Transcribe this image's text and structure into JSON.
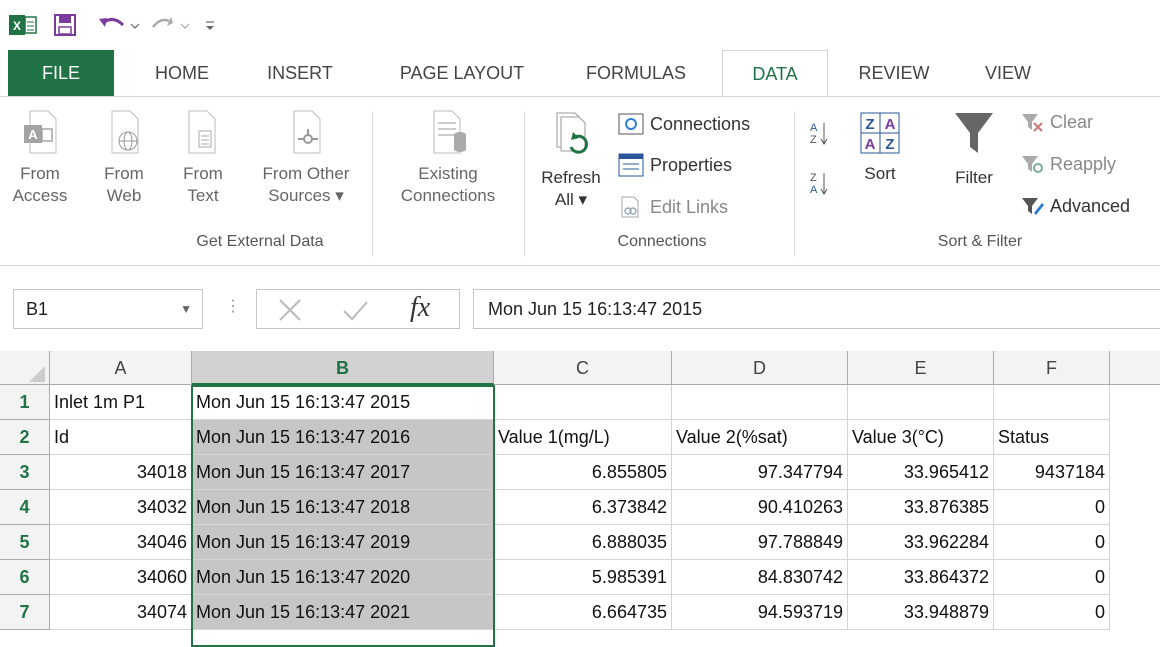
{
  "tabs": [
    "FILE",
    "HOME",
    "INSERT",
    "PAGE LAYOUT",
    "FORMULAS",
    "DATA",
    "REVIEW",
    "VIEW"
  ],
  "ribbon": {
    "get_external": {
      "from_access": [
        "From",
        "Access"
      ],
      "from_web": [
        "From",
        "Web"
      ],
      "from_text": [
        "From",
        "Text"
      ],
      "from_other": [
        "From Other",
        "Sources ▾"
      ],
      "existing": [
        "Existing",
        "Connections"
      ],
      "group_label": "Get External Data"
    },
    "connections": {
      "refresh": [
        "Refresh",
        "All ▾"
      ],
      "connections": "Connections",
      "properties": "Properties",
      "edit_links": "Edit Links",
      "group_label": "Connections"
    },
    "sort_filter": {
      "sort": "Sort",
      "filter": "Filter",
      "clear": "Clear",
      "reapply": "Reapply",
      "advanced": "Advanced",
      "group_label": "Sort & Filter"
    }
  },
  "formula_bar": {
    "name_box": "B1",
    "content": "Mon Jun 15 16:13:47 2015"
  },
  "sheet": {
    "columns": [
      "A",
      "B",
      "C",
      "D",
      "E",
      "F"
    ],
    "rows": [
      {
        "num": "1",
        "cells": [
          "Inlet 1m P1",
          "Mon Jun 15 16:13:47 2015",
          "",
          "",
          "",
          ""
        ]
      },
      {
        "num": "2",
        "cells": [
          "Id",
          "Mon Jun 15 16:13:47 2016",
          "Value 1(mg/L)",
          "Value 2(%sat)",
          "Value 3(°C)",
          "Status"
        ]
      },
      {
        "num": "3",
        "cells": [
          "34018",
          "Mon Jun 15 16:13:47 2017",
          "6.855805",
          "97.347794",
          "33.965412",
          "9437184"
        ]
      },
      {
        "num": "4",
        "cells": [
          "34032",
          "Mon Jun 15 16:13:47 2018",
          "6.373842",
          "90.410263",
          "33.876385",
          "0"
        ]
      },
      {
        "num": "5",
        "cells": [
          "34046",
          "Mon Jun 15 16:13:47 2019",
          "6.888035",
          "97.788849",
          "33.962284",
          "0"
        ]
      },
      {
        "num": "6",
        "cells": [
          "34060",
          "Mon Jun 15 16:13:47 2020",
          "5.985391",
          "84.830742",
          "33.864372",
          "0"
        ]
      },
      {
        "num": "7",
        "cells": [
          "34074",
          "Mon Jun 15 16:13:47 2021",
          "6.664735",
          "94.593719",
          "33.948879",
          "0"
        ]
      }
    ]
  },
  "colors": {
    "accent": "#217346"
  }
}
